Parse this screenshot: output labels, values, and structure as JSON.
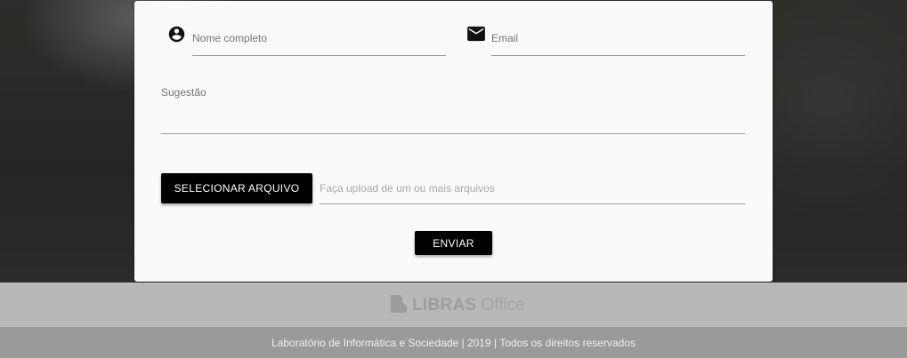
{
  "form": {
    "name_placeholder": "Nome completo",
    "email_placeholder": "Email",
    "suggestion_label": "Sugestão",
    "select_file_button": "SELECIONAR ARQUIVO",
    "upload_placeholder": "Faça upload de um ou mais arquivos",
    "submit_button": "ENVIAR",
    "icons": {
      "name": "account-circle-icon",
      "email": "mail-icon"
    }
  },
  "footer": {
    "logo_bold": "LIBRAS",
    "logo_light": "Office",
    "logo_icon": "document-icon",
    "copyright": "Laboratório de Informática e Sociedade | 2019 | Todos os direitos reservados"
  },
  "colors": {
    "button_bg": "#000000",
    "card_bg": "#fafafa",
    "footer_top": "#b8b8b8",
    "footer_bottom": "#9a9a9a"
  }
}
